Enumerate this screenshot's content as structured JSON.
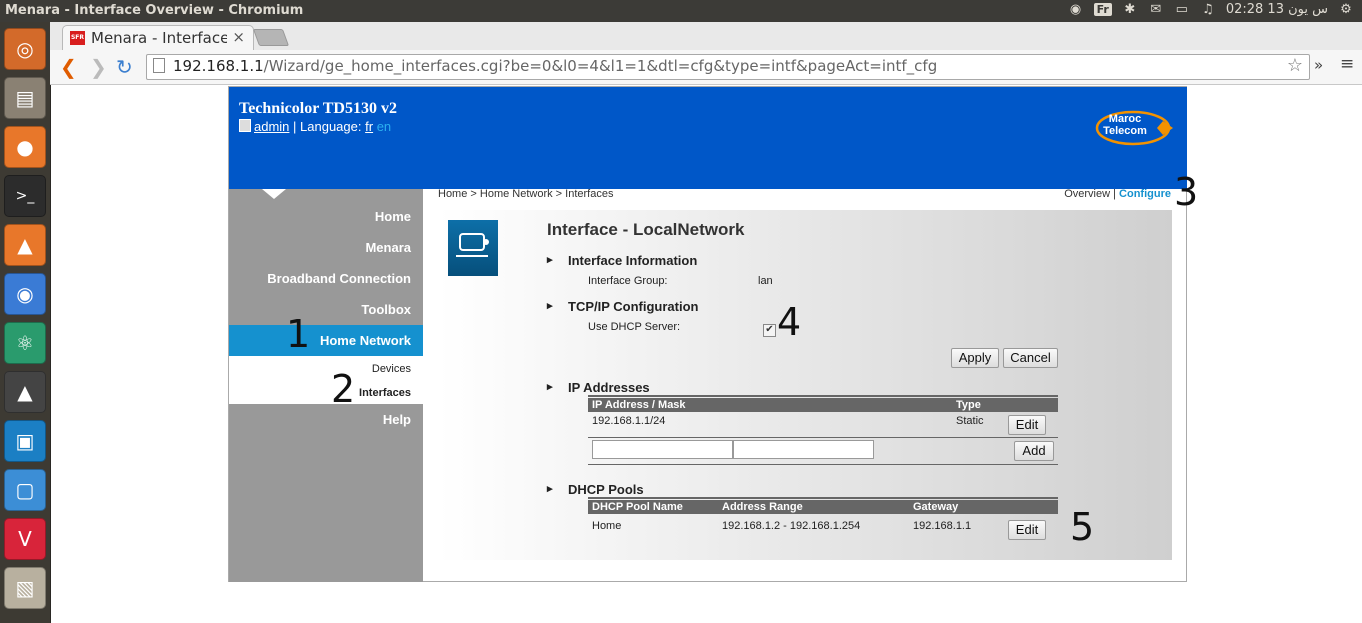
{
  "system": {
    "window_title": "Menara - Interface Overview - Chromium",
    "keyboard": "Fr",
    "clock": "02:28 13 س يون"
  },
  "browser": {
    "tab_title": "Menara - Interface Overview",
    "tab_close": "×",
    "url_host": "192.168.1.1",
    "url_path": "/Wizard/ge_home_interfaces.cgi?be=0&l0=4&l1=1&dtl=cfg&type=intf&pageAct=intf_cfg",
    "overflow": "»",
    "menu": "≡"
  },
  "router": {
    "model": "Technicolor TD5130 v2",
    "user": "admin",
    "language_label": "| Language:",
    "lang_fr": "fr",
    "lang_en": "en",
    "logo_line1": "Maroc",
    "logo_line2": "Telecom",
    "nav": {
      "home": "Home",
      "menara": "Menara",
      "broadband": "Broadband Connection",
      "toolbox": "Toolbox",
      "home_network": "Home Network",
      "devices": "Devices",
      "interfaces": "Interfaces",
      "help": "Help"
    },
    "breadcrumb": "Home > Home Network > Interfaces",
    "overview": "Overview",
    "separator": "|",
    "configure": "Configure",
    "heading": "Interface - LocalNetwork",
    "sections": {
      "info": "Interface Information",
      "tcpip": "TCP/IP Configuration",
      "ip": "IP Addresses",
      "dhcp": "DHCP Pools"
    },
    "interface_group_label": "Interface Group:",
    "interface_group_value": "lan",
    "dhcp_server_label": "Use DHCP Server:",
    "dhcp_server_checked": true,
    "apply": "Apply",
    "cancel": "Cancel",
    "ip_table": {
      "headers": [
        "IP Address / Mask",
        "Type"
      ],
      "rows": [
        [
          "192.168.1.1/24",
          "Static"
        ]
      ]
    },
    "edit": "Edit",
    "add": "Add",
    "dhcp_table": {
      "headers": [
        "DHCP Pool Name",
        "Address Range",
        "Gateway"
      ],
      "rows": [
        [
          "Home",
          "192.168.1.2 - 192.168.1.254",
          "192.168.1.1"
        ]
      ]
    }
  },
  "annotations": [
    "1",
    "2",
    "3",
    "4",
    "5"
  ]
}
